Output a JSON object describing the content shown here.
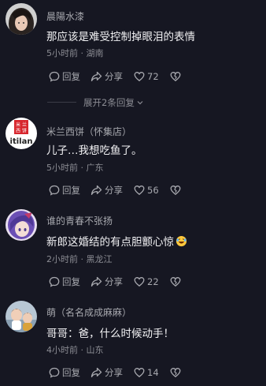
{
  "comments": [
    {
      "username": "晨陽水漆",
      "text": "那应该是难受控制掉眼泪的表情",
      "time_location": "5小时前 · 湖南",
      "reply_label": "回复",
      "share_label": "分享",
      "like_count": "72",
      "avatar_icon": "dark-hair-avatar"
    },
    {
      "username": "米兰西饼（怀集店）",
      "avatar_text": "米兰西饼",
      "avatar_sub": "itilan",
      "text": "儿子…我想吃鱼了。",
      "time_location": "5小时前 · 广东",
      "reply_label": "回复",
      "share_label": "分享",
      "like_count": "56",
      "avatar_icon": "bakery-logo-avatar"
    },
    {
      "username": "谁的青春不张扬",
      "text": "新郎这婚结的有点胆颤心惊",
      "emoji": "rofl-emoji",
      "time_location": "2小时前 · 黑龙江",
      "reply_label": "回复",
      "share_label": "分享",
      "like_count": "22",
      "avatar_icon": "anime-purple-hair-avatar"
    },
    {
      "username": "萌（名名成成麻麻）",
      "text": "哥哥：爸，什么时候动手！",
      "time_location": "4小时前 · 山东",
      "reply_label": "回复",
      "share_label": "分享",
      "like_count": "14",
      "avatar_icon": "child-photo-avatar"
    }
  ],
  "expand_replies": {
    "label": "展开2条回复"
  },
  "colors": {
    "background": "#161722",
    "primary_text": "#f2f2f4",
    "secondary_text": "#a7a8ae",
    "logo_red": "#d7262d"
  }
}
